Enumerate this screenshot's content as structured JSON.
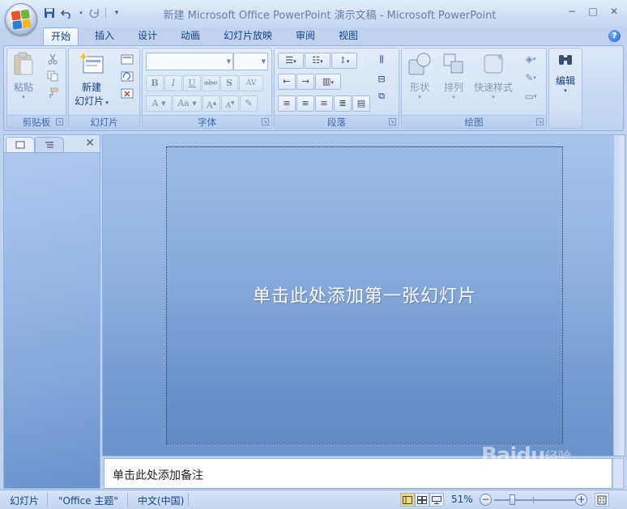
{
  "window": {
    "title": "新建 Microsoft Office PowerPoint 演示文稿 - Microsoft PowerPoint",
    "minimize": "−",
    "maximize": "□",
    "close": "✕"
  },
  "quick_access": {
    "save_icon": "floppy-disk-icon",
    "undo_icon": "undo-icon",
    "redo_icon": "redo-icon",
    "customize_icon": "chevron-down-icon"
  },
  "tabs": [
    {
      "label": "开始",
      "active": true
    },
    {
      "label": "插入",
      "active": false
    },
    {
      "label": "设计",
      "active": false
    },
    {
      "label": "动画",
      "active": false
    },
    {
      "label": "幻灯片放映",
      "active": false
    },
    {
      "label": "审阅",
      "active": false
    },
    {
      "label": "视图",
      "active": false
    }
  ],
  "ribbon": {
    "clipboard": {
      "label": "剪贴板",
      "paste": "粘贴"
    },
    "slides": {
      "label": "幻灯片",
      "new_slide_line1": "新建",
      "new_slide_line2": "幻灯片"
    },
    "font": {
      "label": "字体",
      "font_name": "",
      "font_size": ""
    },
    "paragraph": {
      "label": "段落"
    },
    "drawing": {
      "label": "绘图",
      "shapes": "形状",
      "arrange": "排列",
      "quick_styles": "快速样式"
    },
    "editing": {
      "label": "编辑"
    }
  },
  "slide": {
    "title_placeholder": "单击此处添加第一张幻灯片"
  },
  "notes": {
    "placeholder": "单击此处添加备注"
  },
  "status_bar": {
    "slide": "幻灯片",
    "theme": "\"Office 主题\"",
    "language": "中文(中国)",
    "zoom": "51%",
    "zoom_minus": "−",
    "zoom_plus": "+"
  },
  "watermark": {
    "text": "Baidu",
    "sub": "经验"
  },
  "colors": {
    "accent": "#15428b",
    "ribbon_border": "#8db2e3",
    "slide_top": "#9dbde6",
    "slide_bottom": "#6388c2"
  }
}
